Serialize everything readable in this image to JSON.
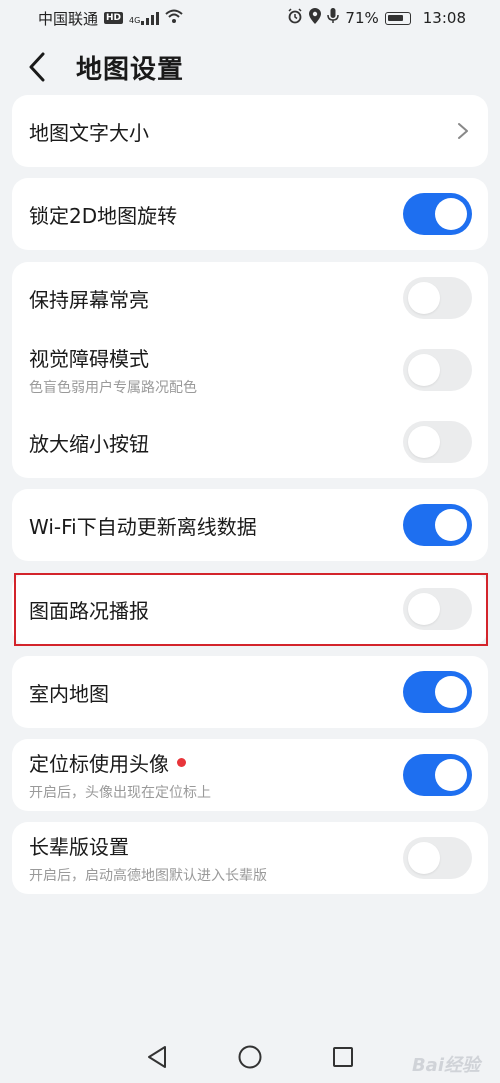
{
  "status_bar": {
    "carrier": "中国联通",
    "hd": "HD",
    "net": "4G",
    "battery": "71%",
    "time": "13:08"
  },
  "header": {
    "title": "地图设置"
  },
  "settings": {
    "map_text_size": {
      "label": "地图文字大小"
    },
    "lock_2d_rotation": {
      "label": "锁定2D地图旋转",
      "on": true
    },
    "keep_screen_on": {
      "label": "保持屏幕常亮",
      "on": false
    },
    "vision_mode": {
      "label": "视觉障碍模式",
      "sub": "色盲色弱用户专属路况配色",
      "on": false
    },
    "zoom_buttons": {
      "label": "放大缩小按钮",
      "on": false
    },
    "wifi_update": {
      "label": "Wi-Fi下自动更新离线数据",
      "on": true
    },
    "traffic_broadcast": {
      "label": "图面路况播报",
      "on": false
    },
    "indoor_map": {
      "label": "室内地图",
      "on": true
    },
    "avatar_marker": {
      "label": "定位标使用头像",
      "sub": "开启后，头像出现在定位标上",
      "on": true
    },
    "elder_mode": {
      "label": "长辈版设置",
      "sub": "开启后，启动高德地图默认进入长辈版",
      "on": false
    }
  },
  "colors": {
    "accent": "#1e6ff0",
    "highlight": "#d3242b",
    "badge_dot": "#e8353a"
  },
  "watermark": "Bai经验"
}
